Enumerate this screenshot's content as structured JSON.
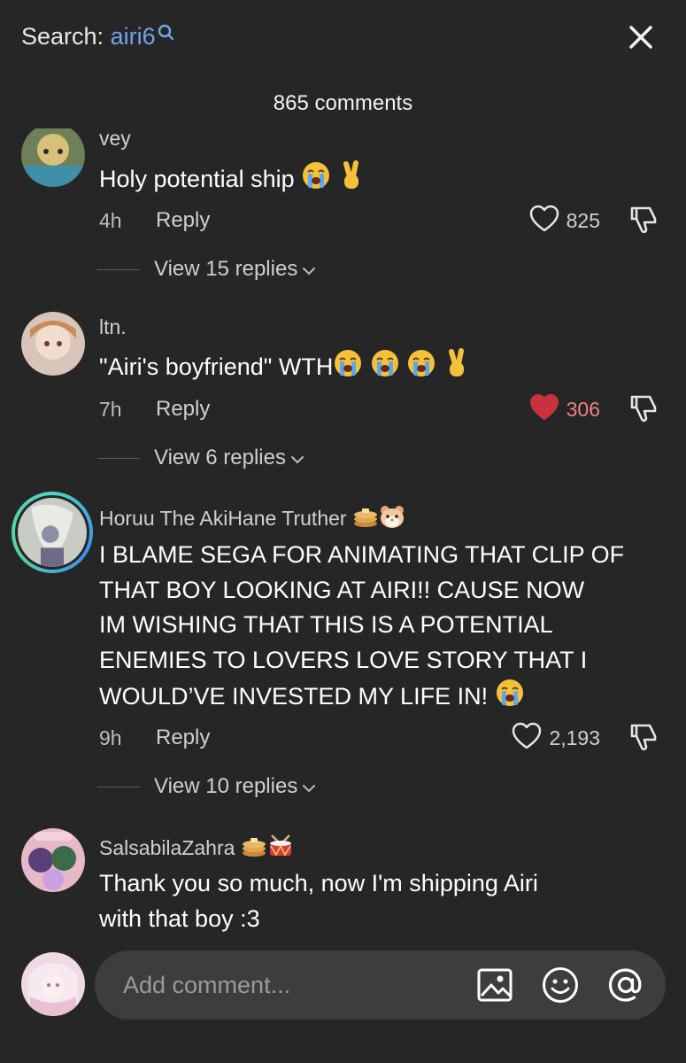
{
  "header": {
    "search_prefix": "Search: ",
    "search_term": "airi6",
    "comment_count": "865 comments"
  },
  "comments": [
    {
      "username": "vey",
      "text": "Holy potential ship",
      "emojis_after": [
        "loudly-crying-face",
        "victory-hand"
      ],
      "time": "4h",
      "reply_label": "Reply",
      "likes": "825",
      "liked": false,
      "replies_label": "View 15 replies"
    },
    {
      "username": "ltn.",
      "text": "\"Airi's boyfriend\" WTH",
      "emojis_after": [
        "loudly-crying-face",
        "loudly-crying-face",
        "loudly-crying-face",
        "victory-hand"
      ],
      "time": "7h",
      "reply_label": "Reply",
      "likes": "306",
      "liked": true,
      "replies_label": "View 6 replies"
    },
    {
      "username": "Horuu The AkiHane Truther",
      "username_emojis": [
        "pancakes",
        "hamster-face"
      ],
      "text_lines": [
        "I BLAME SEGA FOR ANIMATING THAT CLIP OF",
        "THAT BOY LOOKING AT AIRI!! CAUSE NOW",
        "IM WISHING THAT THIS IS A POTENTIAL",
        "ENEMIES TO LOVERS LOVE STORY THAT I",
        "WOULD’VE INVESTED MY LIFE IN!"
      ],
      "emojis_after": [
        "loudly-crying-face"
      ],
      "time": "9h",
      "reply_label": "Reply",
      "likes": "2,193",
      "liked": false,
      "replies_label": "View 10 replies"
    },
    {
      "username": "SalsabilaZahra",
      "username_emojis": [
        "pancakes",
        "drum"
      ],
      "text_lines": [
        "Thank you so much, now I'm shipping Airi",
        "with that boy :3"
      ]
    }
  ],
  "composer": {
    "placeholder": "Add comment..."
  },
  "icons": {
    "close": "close-icon",
    "search": "search-icon",
    "like": "heart-icon",
    "dislike": "thumbs-down-icon",
    "image": "image-icon",
    "emoji": "smiley-icon",
    "mention": "at-sign-icon"
  },
  "colors": {
    "background": "#262626",
    "search_term": "#6fa4ec",
    "liked_heart": "#c8323c",
    "liked_count": "#f08080"
  }
}
